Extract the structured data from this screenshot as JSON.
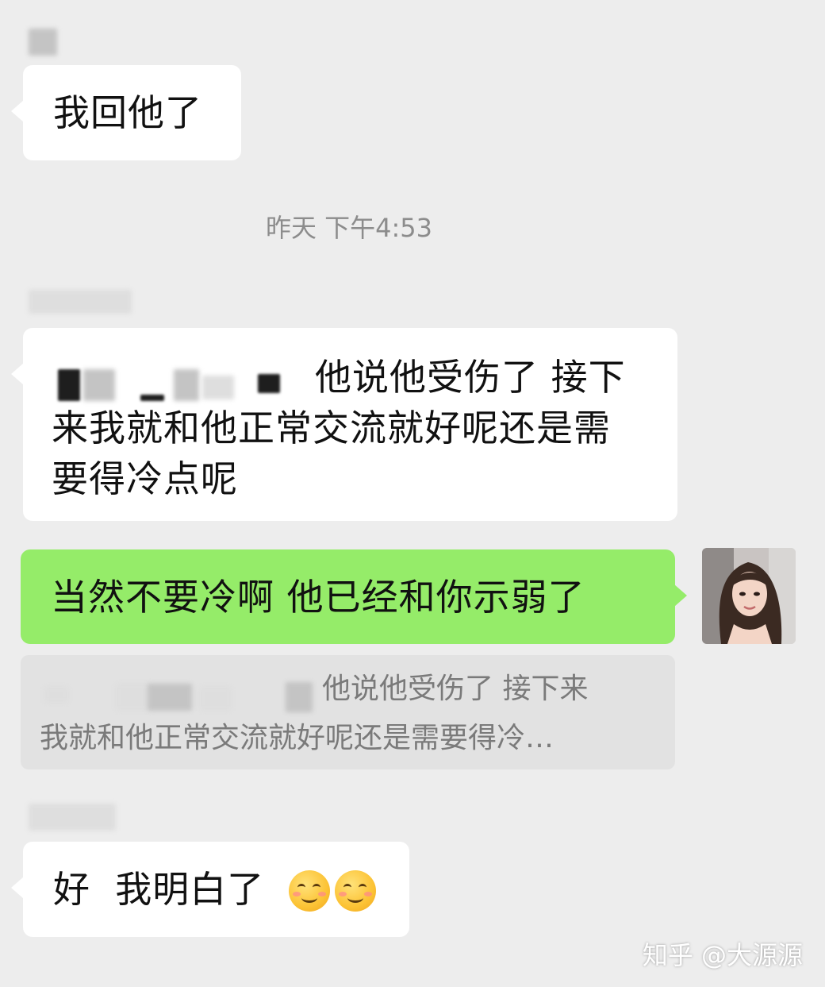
{
  "chat": {
    "messages": [
      {
        "side": "left",
        "text": "我回他了"
      },
      {
        "side": "left",
        "text_line1": "他说他受伤了 接下",
        "text_line2": "来我就和他正常交流就好呢还是需",
        "text_line3": "要得冷点呢"
      },
      {
        "side": "right",
        "text": "当然不要冷啊 他已经和你示弱了",
        "avatar_icon": "user-avatar-photo"
      },
      {
        "side": "left",
        "text": "好  我明白了",
        "emojis": [
          "smiling-face-icon",
          "smiling-face-icon"
        ]
      }
    ],
    "timestamp": "昨天 下午4:53",
    "quote": {
      "line1": "他说他受伤了 接下来",
      "line2": "我就和他正常交流就好呢还是需要得冷…"
    }
  },
  "watermark": "知乎 @大源源",
  "colors": {
    "background": "#ededed",
    "bubble_incoming": "#ffffff",
    "bubble_outgoing": "#95ec69",
    "quote_background": "#e2e2e2"
  }
}
